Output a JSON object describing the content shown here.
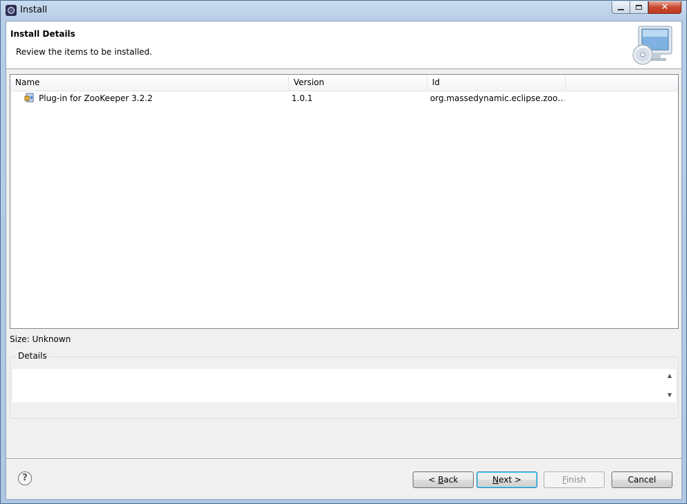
{
  "window": {
    "title": "Install",
    "controls": {
      "minimize": "minimize",
      "maximize": "maximize",
      "close": "✕"
    }
  },
  "header": {
    "title": "Install Details",
    "description": "Review the items to be installed."
  },
  "table": {
    "columns": [
      "Name",
      "Version",
      "Id"
    ],
    "rows": [
      {
        "name": "Plug-in for ZooKeeper 3.2.2",
        "version": "1.0.1",
        "id": "org.massedynamic.eclipse.zoo…",
        "icon": "plugin-icon"
      }
    ]
  },
  "size_label": "Size: Unknown",
  "details": {
    "legend": "Details",
    "text": ""
  },
  "buttons": {
    "help": "?",
    "back": {
      "prefix": "< ",
      "mnemonic": "B",
      "rest": "ack"
    },
    "next": {
      "mnemonic": "N",
      "rest": "ext >"
    },
    "finish": {
      "mnemonic": "F",
      "rest": "inish"
    },
    "cancel": "Cancel"
  },
  "colors": {
    "titlebar": "#c9dcef",
    "dialog_bg": "#f0f0f0",
    "close_button": "#c7482f",
    "default_button_border": "#3c7fb1"
  }
}
